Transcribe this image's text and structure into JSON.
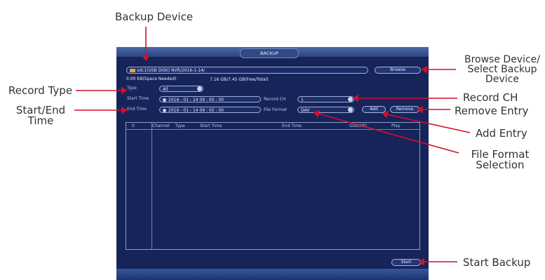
{
  "annotations": {
    "backup_device": "Backup Device",
    "browse_device": "Browse Device/\nSelect Backup\nDevice",
    "record_type": "Record Type",
    "start_end_time": "Start/End\nTime",
    "record_ch": "Record CH",
    "remove_entry": "Remove Entry",
    "add_entry": "Add Entry",
    "file_format_selection": "File Format\nSelection",
    "start_backup": "Start Backup"
  },
  "window": {
    "title": "BACKUP",
    "device_path": "sdc1(USB DISK) NVR/2016-1-14/",
    "space_needed": "0.00 KB(Space Needed)",
    "free_total": "7.16 GB/7.45 GB(Free/Total)",
    "browse_label": "Browse",
    "type_label": "Type",
    "type_value": "All",
    "start_time_label": "Start Time",
    "start_time_value": "2016 - 01 - 14   09 : 00 : 00",
    "end_time_label": "End Time",
    "end_time_value": "2016 - 01 - 14   09 : 05 : 00",
    "record_ch_label": "Record CH",
    "record_ch_value": "1",
    "file_format_label": "File Format",
    "file_format_value": "DAV",
    "add_label": "Add",
    "remove_label": "Remove",
    "start_label": "Start"
  },
  "table": {
    "columns": [
      "0",
      "Channel",
      "Type",
      "Start Time",
      "End Time",
      "Size(KB)",
      "Play"
    ]
  },
  "colors": {
    "window_bg": "#16245a",
    "accent_red": "#d1102d"
  }
}
